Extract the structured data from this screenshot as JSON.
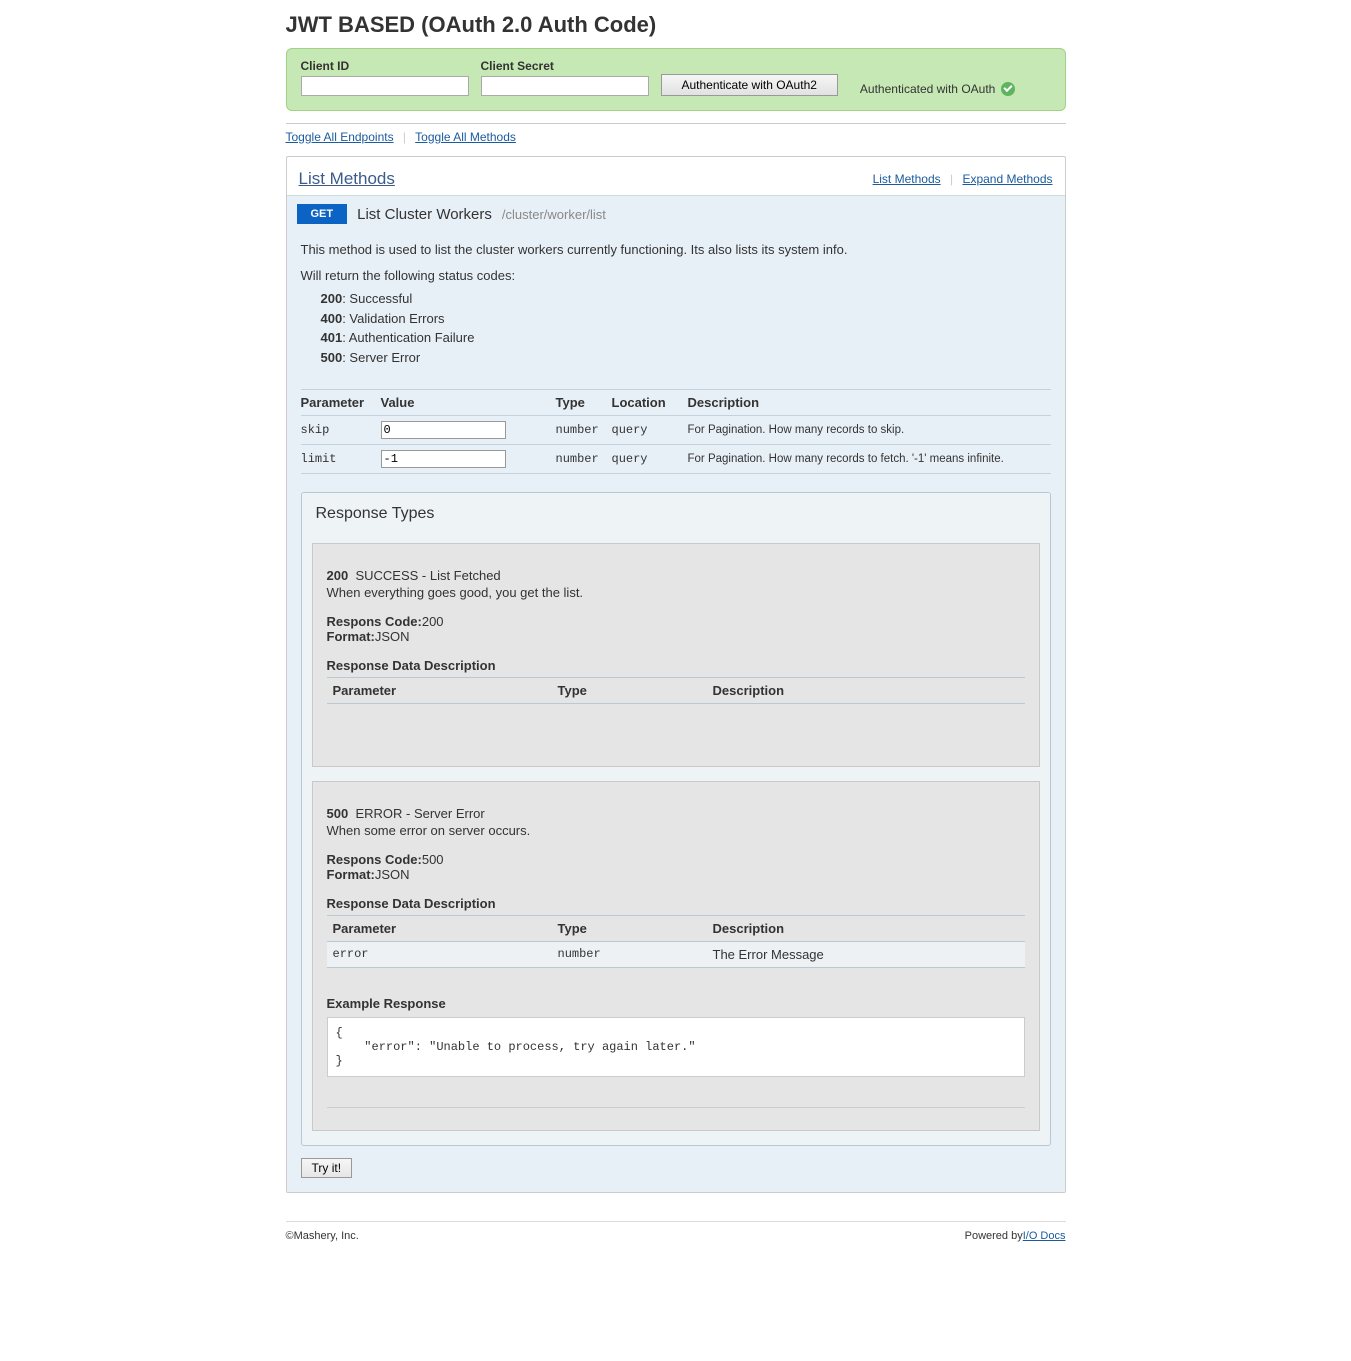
{
  "page_title": "JWT BASED (OAuth 2.0 Auth Code)",
  "credentials": {
    "client_id_label": "Client ID",
    "client_id_value": "",
    "client_secret_label": "Client Secret",
    "client_secret_value": "",
    "auth_button": "Authenticate with OAuth2",
    "auth_status": "Authenticated with OAuth"
  },
  "toggle_links": {
    "endpoints": "Toggle All Endpoints",
    "methods": "Toggle All Methods"
  },
  "endpoint": {
    "title": "List Methods",
    "right_links": {
      "list": "List Methods",
      "expand": "Expand Methods"
    },
    "method": {
      "verb": "GET",
      "name": "List Cluster Workers",
      "path": "/cluster/worker/list",
      "description_1": "This method is used to list the cluster workers currently functioning. Its also lists its system info.",
      "description_2": "Will return the following status codes:",
      "status_codes": [
        {
          "code": "200",
          "text": ": Successful"
        },
        {
          "code": "400",
          "text": ": Validation Errors"
        },
        {
          "code": "401",
          "text": ": Authentication Failure"
        },
        {
          "code": "500",
          "text": ": Server Error"
        }
      ],
      "param_headers": {
        "p": "Parameter",
        "v": "Value",
        "t": "Type",
        "l": "Location",
        "d": "Description"
      },
      "params": [
        {
          "name": "skip",
          "value": "0",
          "type": "number",
          "location": "query",
          "desc": "For Pagination. How many records to skip."
        },
        {
          "name": "limit",
          "value": "-1",
          "type": "number",
          "location": "query",
          "desc": "For Pagination. How many records to fetch. '-1' means infinite."
        }
      ],
      "response_types_title": "Response Types",
      "responses": [
        {
          "code": "200",
          "title": "SUCCESS - List Fetched",
          "sub": "When everything goes good, you get the list.",
          "respons_code_label": "Respons Code:",
          "respons_code": "200",
          "format_label": "Format:",
          "format": "JSON",
          "data_desc_title": "Response Data Description",
          "headers": {
            "p": "Parameter",
            "t": "Type",
            "d": "Description"
          },
          "rows": []
        },
        {
          "code": "500",
          "title": "ERROR - Server Error",
          "sub": "When some error on server occurs.",
          "respons_code_label": "Respons Code:",
          "respons_code": "500",
          "format_label": "Format:",
          "format": "JSON",
          "data_desc_title": "Response Data Description",
          "headers": {
            "p": "Parameter",
            "t": "Type",
            "d": "Description"
          },
          "rows": [
            {
              "param": "error",
              "type": "number",
              "desc": "The Error Message"
            }
          ],
          "example_title": "Example Response",
          "example": "{\n    \"error\": \"Unable to process, try again later.\"\n}"
        }
      ],
      "try_button": "Try it!"
    }
  },
  "footer": {
    "copyright": "©Mashery, Inc.",
    "powered_prefix": "Powered by",
    "powered_link": "I/O Docs"
  }
}
